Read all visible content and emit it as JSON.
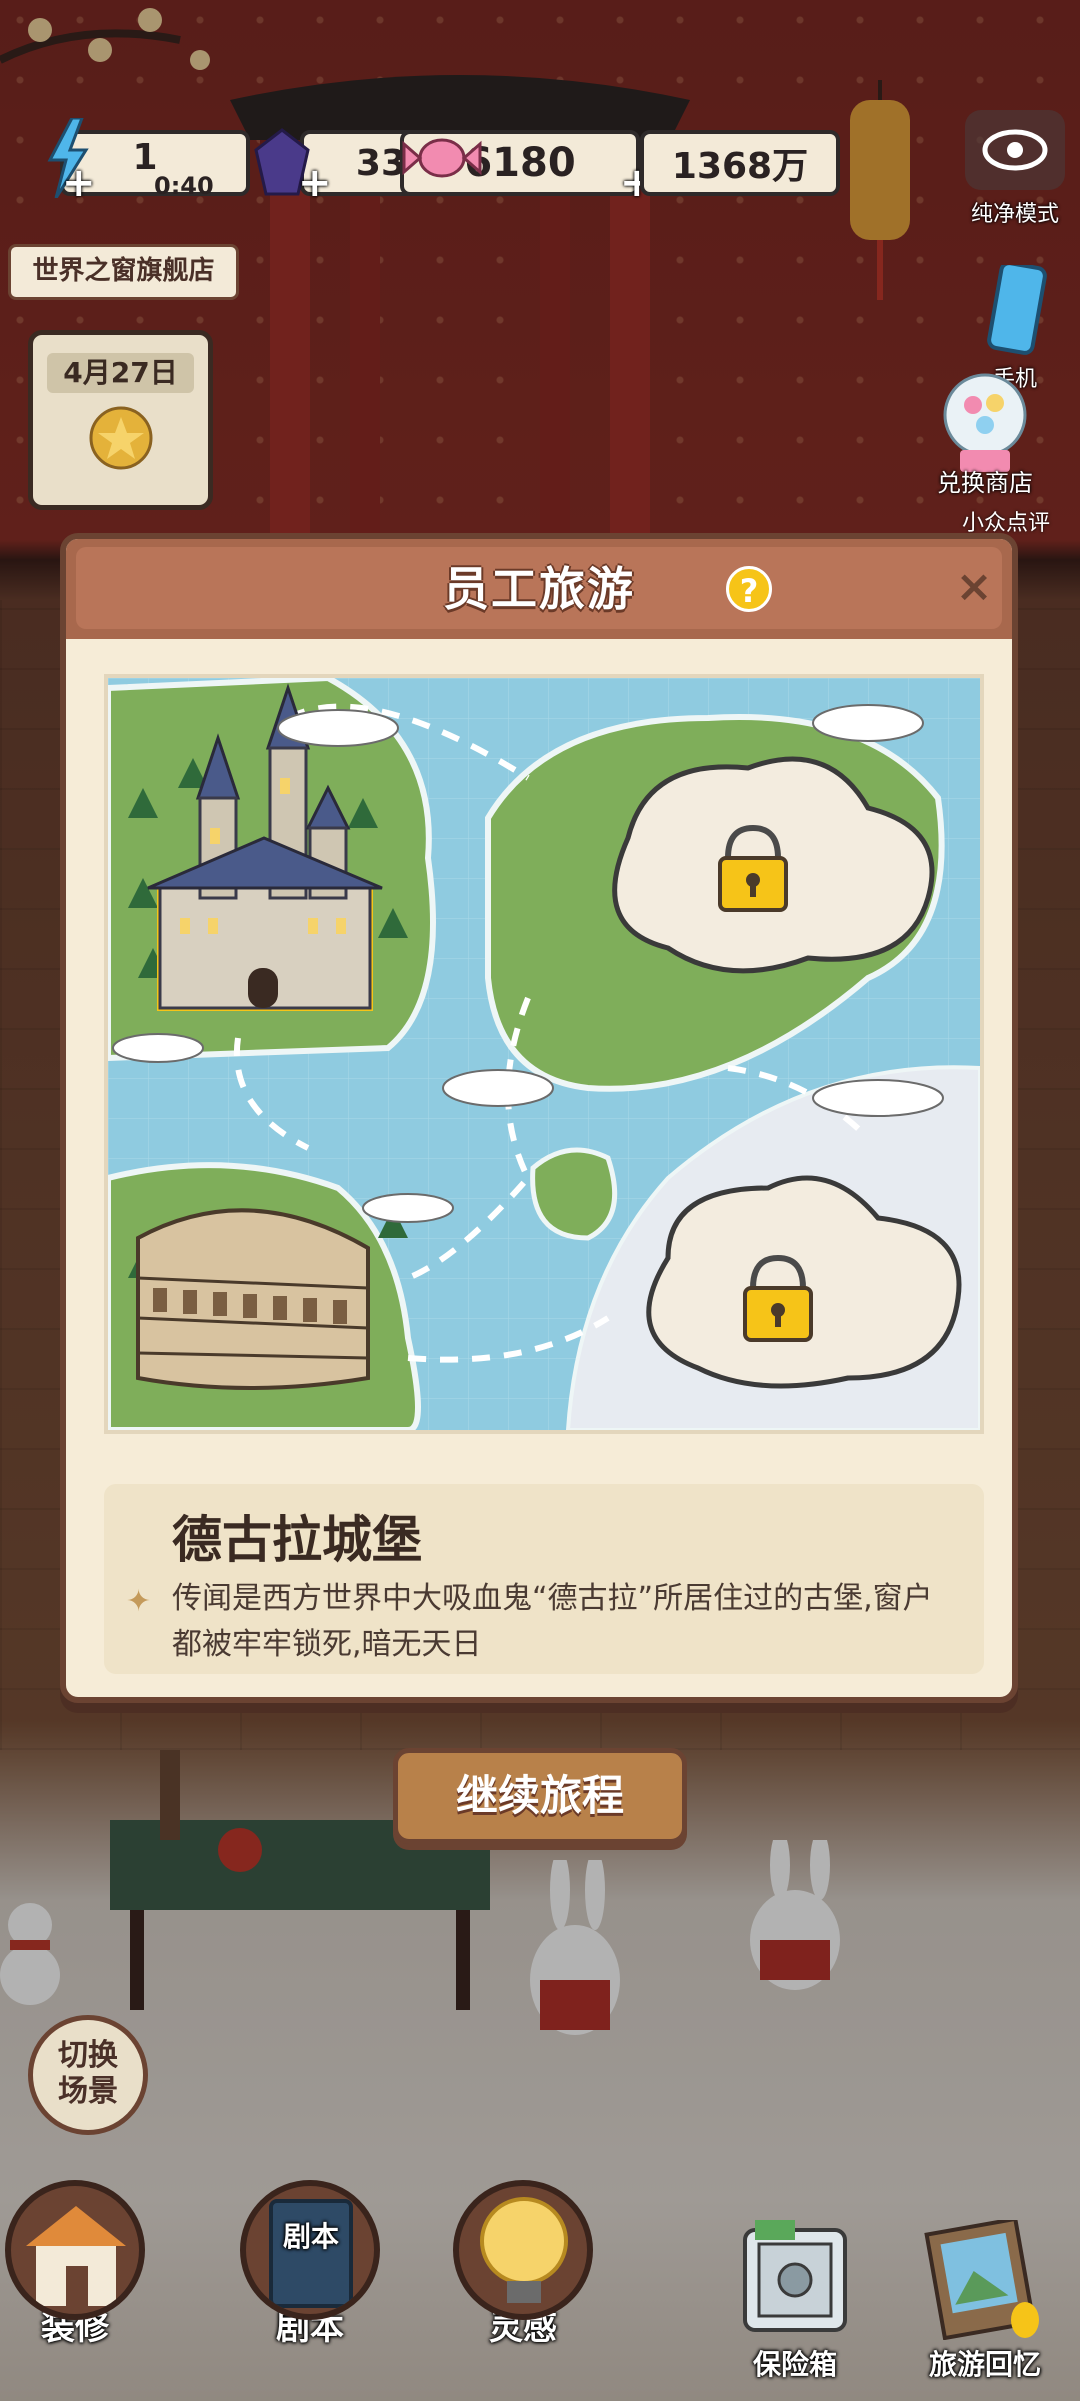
{
  "top_bar": {
    "energy": "1",
    "energy_timer": "0:40",
    "gems": "33",
    "candy": "6180",
    "money": "1368万",
    "plus": "+"
  },
  "store_name": "世界之窗旗舰店",
  "date": "4月27日",
  "side": {
    "pure_mode": "纯净模式",
    "phone": "手机",
    "exchange_shop": "兑换商店",
    "review": "小众点评"
  },
  "dialog": {
    "title": "员工旅游",
    "help": "?",
    "close": "×",
    "location_name": "德古拉城堡",
    "location_desc": "传闻是西方世界中大吸血鬼“德古拉”所居住过的古堡,窗户都被牢牢锁死,暗无天日",
    "continue": "继续旅程"
  },
  "switch_scene": "切换\n场景",
  "bottom": {
    "decorate": "装修",
    "script": "剧本",
    "script_book": "剧本",
    "inspiration": "灵感",
    "safe": "保险箱",
    "travel_memory": "旅游回忆"
  },
  "colors": {
    "dialog_bg": "#f6ecd7",
    "header": "#b97559",
    "sea": "#8fcbe0",
    "land": "#7fae5a",
    "button": "#b8814a",
    "help": "#f6c418"
  }
}
